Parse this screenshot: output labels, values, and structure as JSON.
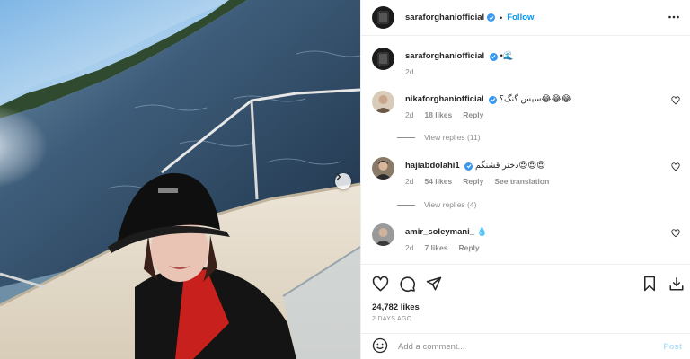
{
  "post": {
    "author": "saraforghaniofficial",
    "follow_label": "Follow",
    "dot": "•",
    "more_icon": "more-horizontal-icon"
  },
  "caption": {
    "username": "saraforghaniofficial",
    "text": "•🌊",
    "time": "2d"
  },
  "comments": [
    {
      "username": "nikaforghaniofficial",
      "text": "سیس گنگ؟😂😂😂",
      "time": "2d",
      "likes": "18 likes",
      "reply_label": "Reply",
      "view_replies": "View replies (11)"
    },
    {
      "username": "hajiabdolahi1",
      "text": "دختر قشنگم😍😍😍",
      "time": "2d",
      "likes": "54 likes",
      "reply_label": "Reply",
      "translation_label": "See translation",
      "view_replies": "View replies (4)"
    },
    {
      "username": "amir_soleymani_",
      "text": "💧",
      "time": "2d",
      "likes": "7 likes",
      "reply_label": "Reply"
    }
  ],
  "engagement": {
    "likes": "24,782 likes",
    "date": "2 DAYS AGO"
  },
  "composer": {
    "placeholder": "Add a comment...",
    "post_label": "Post"
  },
  "colors": {
    "accent": "#0095f6",
    "verified": "#3897f0",
    "muted": "#8e8e8e",
    "post_disabled": "#b2dffc"
  }
}
